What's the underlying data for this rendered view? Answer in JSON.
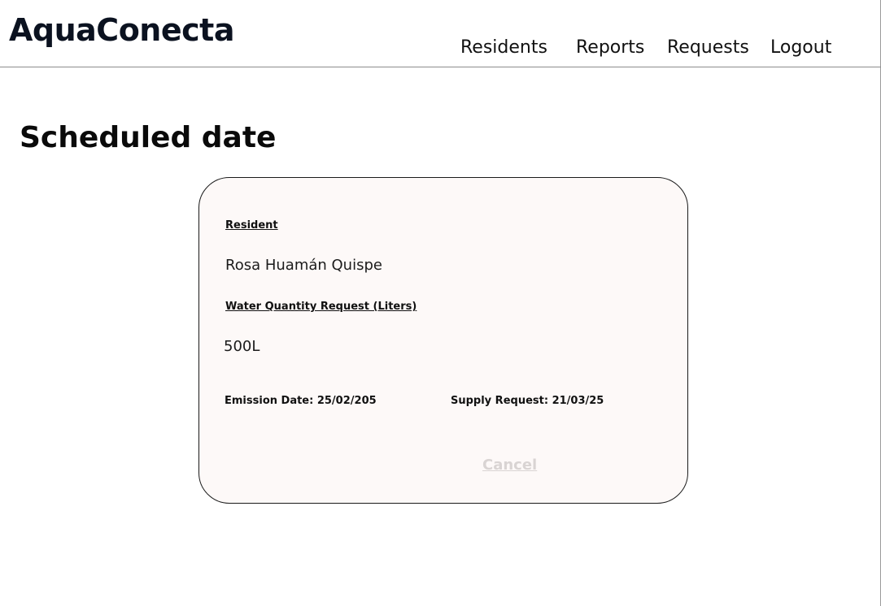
{
  "header": {
    "logo": "AquaConecta",
    "nav": {
      "residents": "Residents",
      "reports": "Reports",
      "requests": "Requests",
      "logout": "Logout"
    }
  },
  "page": {
    "title": "Scheduled date"
  },
  "card": {
    "resident_label": "Resident",
    "resident_name": "Rosa Huamán Quispe",
    "quantity_label": "Water Quantity Request  (Liters)",
    "quantity_value": "500L",
    "emission_date": "Emission Date: 25/02/205",
    "supply_request": "Supply Request: 21/03/25",
    "cancel_label": "Cancel"
  },
  "colors": {
    "card_background": "#fdf9f8",
    "cancel_text": "#d9d4d3",
    "logo_text": "#0b1220"
  }
}
